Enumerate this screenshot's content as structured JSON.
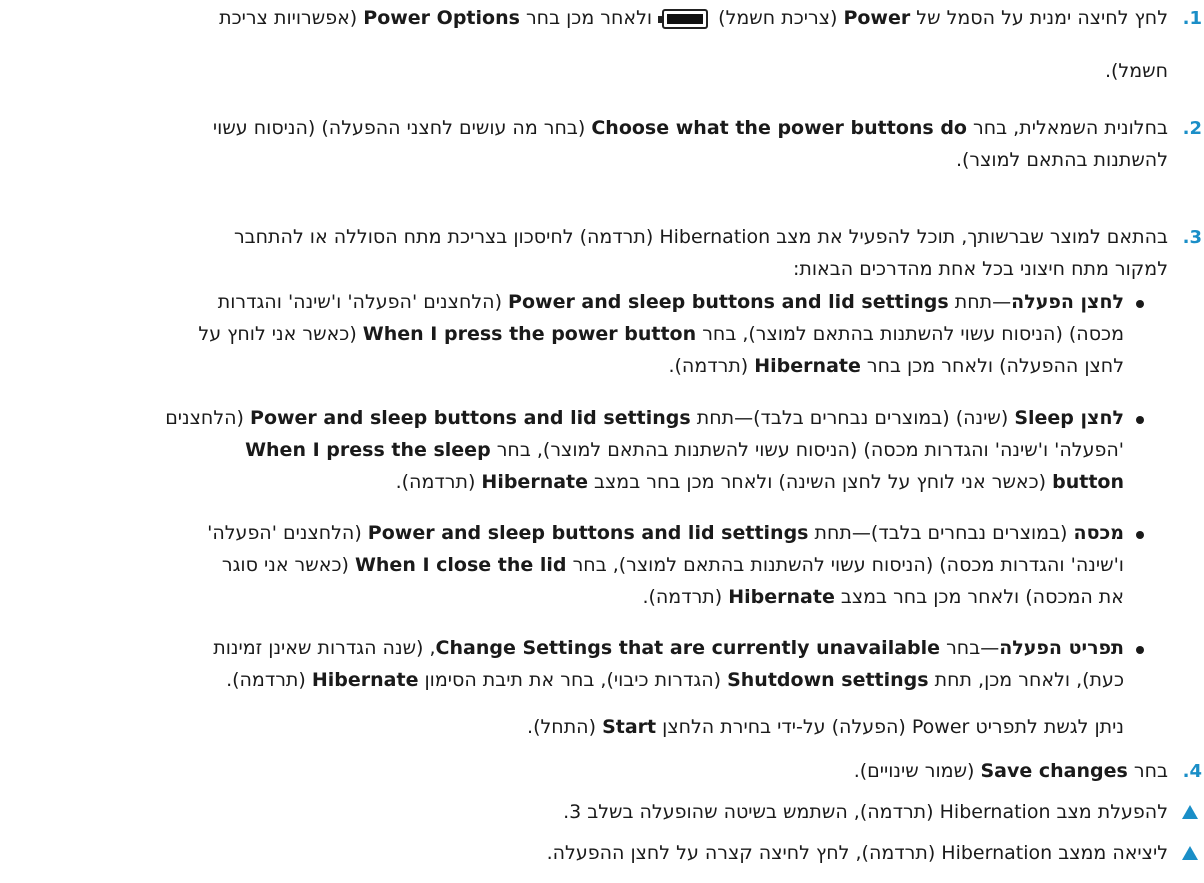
{
  "steps": [
    {
      "number": "1.",
      "l1_a": "לחץ לחיצה ימנית על הסמל של ",
      "l1_b": "Power",
      "l1_c": " (צריכת חשמל) ",
      "l1_d": " ולאחר מכן בחר ",
      "l1_e": "Power Options",
      "l1_f": " (אפשרויות צריכת",
      "l2": "חשמל).",
      "icon": "battery-icon"
    },
    {
      "number": "2.",
      "l1_a": "בחלונית השמאלית, בחר ",
      "l1_b": "Choose what the power buttons do",
      "l1_c": " (בחר מה עושים לחצני ההפעלה) (הניסוח עשוי",
      "l2": "להשתנות בהתאם למוצר)."
    },
    {
      "number": "3.",
      "l1": "בהתאם למוצר שברשותך, תוכל להפעיל את מצב Hibernation (תרדמה) לחיסכון בצריכת מתח הסוללה או להתחבר",
      "l2": "למקור מתח חיצוני בכל אחת מהדרכים הבאות:"
    },
    {
      "number": "4.",
      "a": "בחר ",
      "b": "Save changes",
      "c": " (שמור שינויים)."
    }
  ],
  "bullets": [
    {
      "l1_a": "לחצן הפעלה",
      "l1_b": "—תחת ",
      "l1_c": "Power and sleep buttons and lid settings",
      "l1_d": " (הלחצנים 'הפעלה' ו'שינה' והגדרות",
      "l2_a": "מכסה) (הניסוח עשוי להשתנות בהתאם למוצר), בחר ",
      "l2_b": "When I press the power button",
      "l2_c": " (כאשר אני לוחץ על",
      "l3_a": "לחצן ההפעלה) ולאחר מכן בחר ",
      "l3_b": "Hibernate",
      "l3_c": " (תרדמה)."
    },
    {
      "l1_a": "לחצן Sleep",
      "l1_b": " (שינה) (במוצרים נבחרים בלבד)—תחת ",
      "l1_c": "Power and sleep buttons and lid settings",
      "l1_d": " (הלחצנים",
      "l2_a": "'הפעלה' ו'שינה' והגדרות מכסה) (הניסוח עשוי להשתנות בהתאם למוצר), בחר ",
      "l2_b": "When I press the sleep",
      "l3_a": "button",
      "l3_b": " (כאשר אני לוחץ על לחצן השינה) ולאחר מכן בחר במצב ",
      "l3_c": "Hibernate",
      "l3_d": " (תרדמה)."
    },
    {
      "l1_a": "מכסה",
      "l1_b": " (במוצרים נבחרים בלבד)—תחת ",
      "l1_c": "Power and sleep buttons and lid settings",
      "l1_d": " (הלחצנים 'הפעלה'",
      "l2_a": "ו'שינה' והגדרות מכסה) (הניסוח עשוי להשתנות בהתאם למוצר), בחר ",
      "l2_b": "When I close the lid",
      "l2_c": " (כאשר אני סוגר",
      "l3_a": "את המכסה) ולאחר מכן בחר במצב ",
      "l3_b": "Hibernate",
      "l3_c": " (תרדמה)."
    },
    {
      "l1_a": "תפריט הפעלה",
      "l1_b": "—בחר ",
      "l1_c": "Change Settings that are currently unavailable",
      "l1_d": ", (שנה הגדרות שאינן זמינות",
      "l2_a": "כעת), ולאחר מכן, תחת ",
      "l2_b": "Shutdown settings",
      "l2_c": " (הגדרות כיבוי), בחר את תיבת הסימון ",
      "l2_d": "Hibernate",
      "l2_e": " (תרדמה)."
    }
  ],
  "note": {
    "a": "ניתן לגשת לתפריט Power (הפעלה) על-ידי בחירת הלחצן ",
    "b": "Start",
    "c": " (התחל)."
  },
  "tips": [
    {
      "text": "להפעלת מצב Hibernation (תרדמה), השתמש בשיטה שהופעלה בשלב 3."
    },
    {
      "text": "ליציאה ממצב Hibernation (תרדמה), לחץ לחיצה קצרה על לחצן ההפעלה."
    }
  ],
  "colors": {
    "accent": "#1a8ec7",
    "text": "#1a1a1a"
  }
}
